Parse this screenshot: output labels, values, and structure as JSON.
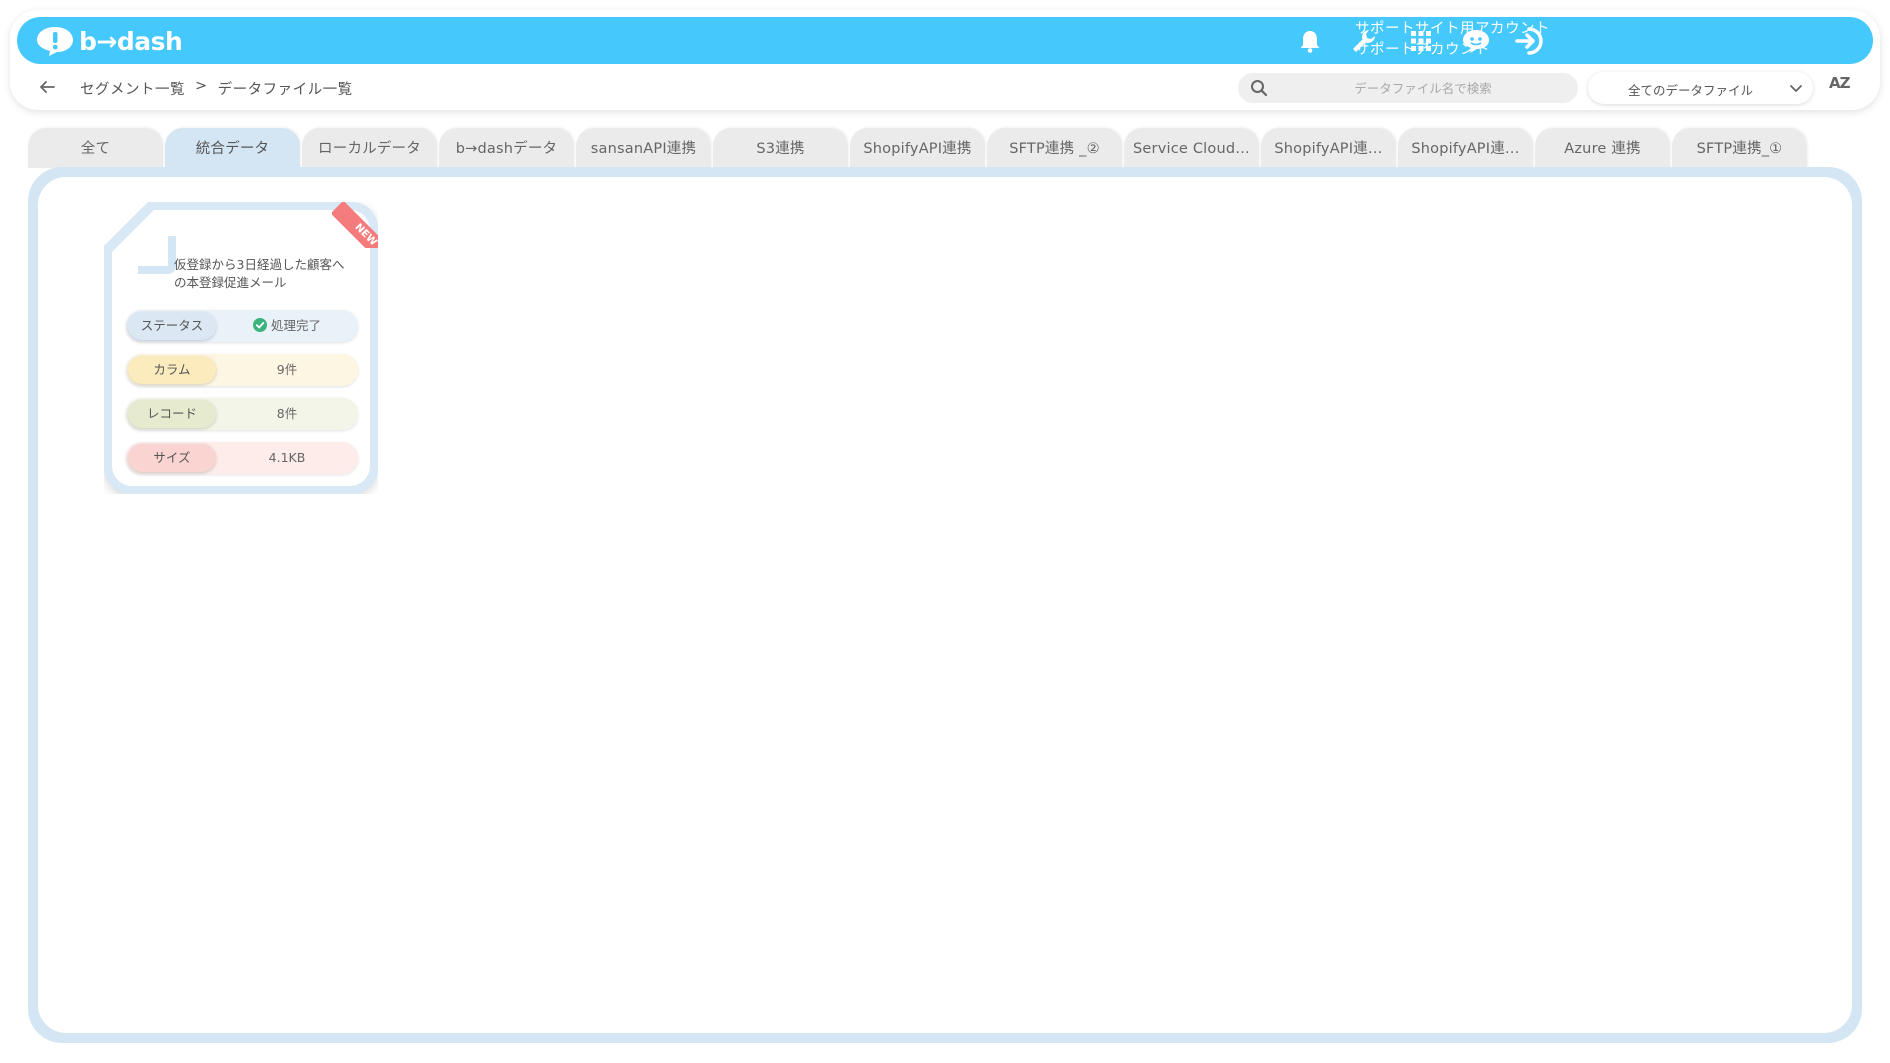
{
  "header": {
    "logo_text": "b→dash",
    "account_line1": "サポートサイト用アカウント",
    "account_line2": "サポートアカウント",
    "icons": [
      "bell-icon",
      "wrench-icon",
      "apps-grid-icon",
      "support-chat-icon",
      "logout-icon"
    ],
    "brand_color": "#45c8fb"
  },
  "subbar": {
    "breadcrumb_parent": "セグメント一覧",
    "breadcrumb_separator": ">",
    "breadcrumb_current": "データファイル一覧",
    "search_placeholder": "データファイル名で検索",
    "filter_selected": "全てのデータファイル",
    "sort_label": "AZ"
  },
  "tabs": [
    {
      "label": "全て",
      "active": false
    },
    {
      "label": "統合データ",
      "active": true
    },
    {
      "label": "ローカルデータ",
      "active": false
    },
    {
      "label": "b→dashデータ",
      "active": false
    },
    {
      "label": "sansanAPI連携",
      "active": false
    },
    {
      "label": "S3連携",
      "active": false
    },
    {
      "label": "ShopifyAPI連携",
      "active": false
    },
    {
      "label": "SFTP連携 _②",
      "active": false
    },
    {
      "label": "Service Cloud…",
      "active": false
    },
    {
      "label": "ShopifyAPI連…",
      "active": false
    },
    {
      "label": "ShopifyAPI連…",
      "active": false
    },
    {
      "label": "Azure 連携",
      "active": false
    },
    {
      "label": "SFTP連携_①",
      "active": false
    }
  ],
  "cards": [
    {
      "badge": "NEW",
      "title": "仮登録から3日経過した顧客への本登録促進メール",
      "status_label": "ステータス",
      "status_value": "処理完了",
      "column_label": "カラム",
      "column_value": "9件",
      "record_label": "レコード",
      "record_value": "8件",
      "size_label": "サイズ",
      "size_value": "4.1KB"
    }
  ]
}
